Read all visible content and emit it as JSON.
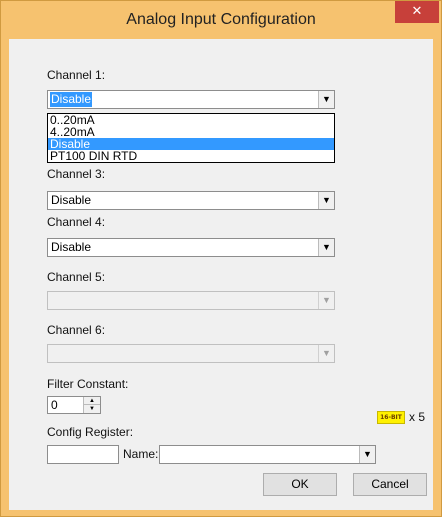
{
  "window": {
    "title": "Analog Input Configuration",
    "close_glyph": "✕"
  },
  "channels": [
    {
      "label": "Channel 1:",
      "value": "Disable",
      "enabled": true,
      "selected": true
    },
    {
      "label": "Channel 3:",
      "value": "Disable",
      "enabled": true
    },
    {
      "label": "Channel 4:",
      "value": "Disable",
      "enabled": true
    },
    {
      "label": "Channel 5:",
      "value": "",
      "enabled": false
    },
    {
      "label": "Channel 6:",
      "value": "",
      "enabled": false
    }
  ],
  "dropdown": {
    "options": [
      "0..20mA",
      "4..20mA",
      "Disable",
      "PT100 DIN RTD"
    ],
    "highlighted": "Disable"
  },
  "filter": {
    "label": "Filter Constant:",
    "value": "0"
  },
  "config": {
    "label": "Config Register:",
    "register_value": "",
    "name_label": "Name:",
    "name_value": "",
    "badge_text": "16-BIT",
    "multiplier": "x 5"
  },
  "buttons": {
    "ok": "OK",
    "cancel": "Cancel"
  },
  "colors": {
    "titlebar": "#f6c26f",
    "close": "#c7403a",
    "highlight": "#3399ff",
    "badge": "#fff100"
  },
  "icons": {
    "combo_arrow": "▼",
    "spin_up": "▲",
    "spin_down": "▼"
  }
}
